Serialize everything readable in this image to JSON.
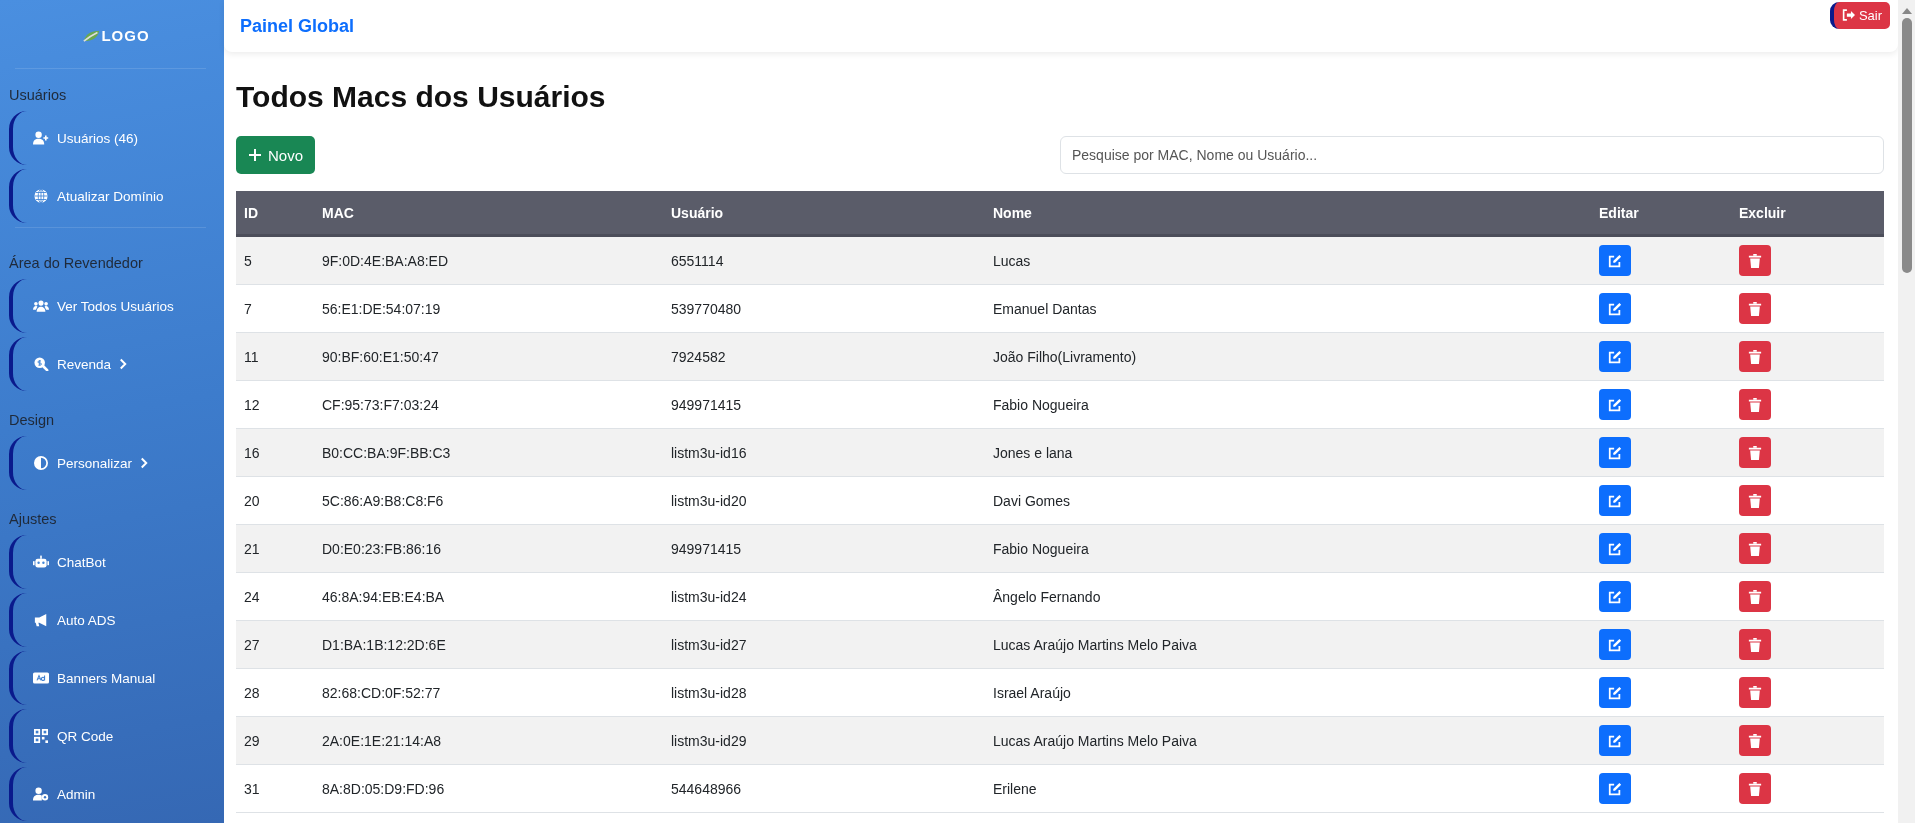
{
  "sidebar": {
    "logo": "LOGO",
    "sections": [
      {
        "title": "Usuários",
        "items": [
          {
            "label": "Usuários (46)",
            "submenu": false
          },
          {
            "label": "Atualizar Domínio",
            "submenu": false
          }
        ]
      },
      {
        "title": "Área do Revendedor",
        "items": [
          {
            "label": "Ver Todos Usuários",
            "submenu": false
          },
          {
            "label": "Revenda",
            "submenu": true
          }
        ]
      },
      {
        "title": "Design",
        "items": [
          {
            "label": "Personalizar",
            "submenu": true
          }
        ]
      },
      {
        "title": "Ajustes",
        "items": [
          {
            "label": "ChatBot",
            "submenu": false
          },
          {
            "label": "Auto ADS",
            "submenu": false
          },
          {
            "label": "Banners Manual",
            "submenu": false
          },
          {
            "label": "QR Code",
            "submenu": false
          },
          {
            "label": "Admin",
            "submenu": false
          }
        ]
      }
    ]
  },
  "header": {
    "title": "Painel Global",
    "logout": "Sair"
  },
  "page_title": "Todos Macs dos Usuários",
  "new_button": "Novo",
  "search": {
    "placeholder": "Pesquise por MAC, Nome ou Usuário..."
  },
  "table": {
    "columns": [
      "ID",
      "MAC",
      "Usuário",
      "Nome",
      "Editar",
      "Excluir"
    ],
    "rows": [
      {
        "id": "5",
        "mac": "9F:0D:4E:BA:A8:ED",
        "usuario": "6551114",
        "nome": "Lucas"
      },
      {
        "id": "7",
        "mac": "56:E1:DE:54:07:19",
        "usuario": "539770480",
        "nome": "Emanuel Dantas"
      },
      {
        "id": "11",
        "mac": "90:BF:60:E1:50:47",
        "usuario": "7924582",
        "nome": "João Filho(Livramento)"
      },
      {
        "id": "12",
        "mac": "CF:95:73:F7:03:24",
        "usuario": "949971415",
        "nome": "Fabio Nogueira"
      },
      {
        "id": "16",
        "mac": "B0:CC:BA:9F:BB:C3",
        "usuario": "listm3u-id16",
        "nome": "Jones e lana"
      },
      {
        "id": "20",
        "mac": "5C:86:A9:B8:C8:F6",
        "usuario": "listm3u-id20",
        "nome": "Davi Gomes"
      },
      {
        "id": "21",
        "mac": "D0:E0:23:FB:86:16",
        "usuario": "949971415",
        "nome": "Fabio Nogueira"
      },
      {
        "id": "24",
        "mac": "46:8A:94:EB:E4:BA",
        "usuario": "listm3u-id24",
        "nome": "Ângelo Fernando"
      },
      {
        "id": "27",
        "mac": "D1:BA:1B:12:2D:6E",
        "usuario": "listm3u-id27",
        "nome": "Lucas Araújo Martins Melo Paiva"
      },
      {
        "id": "28",
        "mac": "82:68:CD:0F:52:77",
        "usuario": "listm3u-id28",
        "nome": "Israel Araújo"
      },
      {
        "id": "29",
        "mac": "2A:0E:1E:21:14:A8",
        "usuario": "listm3u-id29",
        "nome": "Lucas Araújo Martins Melo Paiva"
      },
      {
        "id": "31",
        "mac": "8A:8D:05:D9:FD:96",
        "usuario": "544648966",
        "nome": "Erilene"
      }
    ]
  }
}
